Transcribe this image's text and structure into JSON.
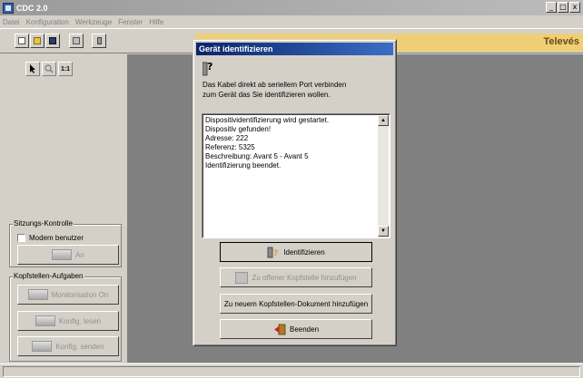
{
  "app": {
    "title": "CDC 2.0"
  },
  "window_controls": {
    "minimize": "_",
    "maximize": "□",
    "close": "x"
  },
  "menu": [
    "Datei",
    "Konfiguration",
    "Werkzeuge",
    "Fenster",
    "Hilfe"
  ],
  "toolbar": {
    "buttons": [
      "new-document-icon",
      "open-folder-icon",
      "save-icon",
      "print-icon",
      "identify-device-icon"
    ],
    "brand": "Televés",
    "brand_color": "#efcf76"
  },
  "left_panel": {
    "tools": [
      "pointer-icon",
      "zoom-icon",
      "fit-icon"
    ],
    "fit_label": "1:1",
    "session": {
      "legend": "Sitzungs-Kontrolle",
      "modem_label": "Modem benutzer",
      "modem_checked": false,
      "connect_label": "An"
    },
    "headend": {
      "legend": "Kopfstellen-Aufgaben",
      "buttons": [
        "Monitorisation On",
        "Konfig. lesen",
        "Konfig. senden"
      ]
    }
  },
  "dialog": {
    "title": "Gerät identifizieren",
    "instruction_line1": "Das Kabel direkt ab seriellem Port verbinden",
    "instruction_line2": "zum Gerät das Sie identifizieren wollen.",
    "log": [
      "Dispositividentifizierung wird gestartet.",
      "Dispositiv gefunden!",
      "Adresse: 222",
      "Referenz: 5325",
      "Beschreibung: Avant 5 - Avant 5",
      "Identifizierung beendet."
    ],
    "buttons": {
      "identify": "Identifizieren",
      "add_open": "Zu offener Kopfstelle hinzufügen",
      "add_new": "Zu neuem Kopfstellen-Dokument hinzufügen",
      "quit": "Beenden"
    }
  }
}
